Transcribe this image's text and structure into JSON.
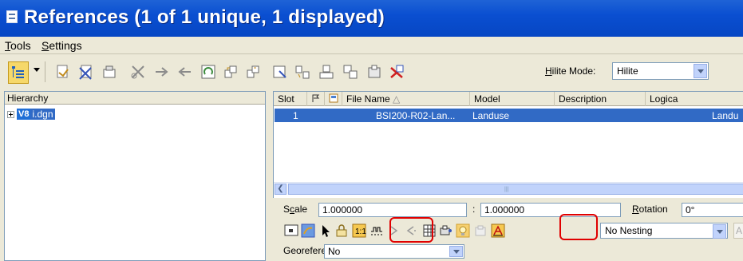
{
  "window": {
    "title": "References (1 of 1 unique, 1 displayed)"
  },
  "menu": {
    "items": [
      {
        "label": "Tools",
        "accel": "T"
      },
      {
        "label": "Settings",
        "accel": "S"
      }
    ]
  },
  "toolbar": {
    "hilite_label": "Hilite Mode:",
    "hilite_value": "Hilite",
    "icons": [
      "hierarchy-icon",
      "attach-icon",
      "detach-icon",
      "reload-icon",
      "clip-boundary-icon",
      "clip-mask-icon",
      "clip-delete-icon",
      "rotate-icon",
      "attach-copy-icon",
      "move-icon",
      "scale-icon",
      "mirror-h-icon",
      "mirror-v-icon",
      "copy-icon",
      "merge-icon",
      "exchange-icon",
      "delete-icon"
    ]
  },
  "hierarchy": {
    "header": "Hierarchy",
    "root": {
      "badge": "V8",
      "label": "i.dgn"
    }
  },
  "grid": {
    "columns": [
      "Slot",
      "",
      "",
      "File Name",
      "Model",
      "Description",
      "Logica"
    ],
    "rows": [
      {
        "slot": "1",
        "file": "BSI200-R02-Lan...",
        "model": "Landuse",
        "description": "",
        "logical": "Landu"
      }
    ]
  },
  "settings": {
    "scale_label": "Scale",
    "scale_value_1": "1.000000",
    "colon": ":",
    "scale_value_2": "1.000000",
    "rotation_label": "Rotation",
    "rotation_value": "0°",
    "nesting_value": "No Nesting",
    "extra_box": "A",
    "georef_label": "Georeferenced:",
    "georef_value": "No"
  },
  "colors": {
    "titlebar": "#0646c3",
    "selection": "#316ac5",
    "highlight_ring": "#e00000",
    "chrome": "#ece9d8"
  }
}
